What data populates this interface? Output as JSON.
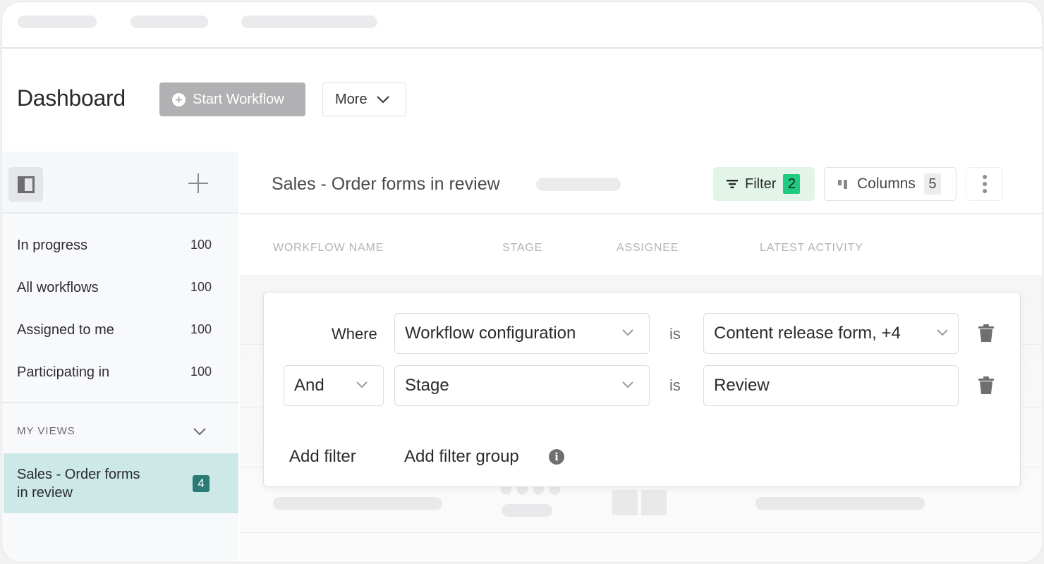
{
  "header": {
    "title": "Dashboard",
    "start_workflow_label": "Start Workflow",
    "more_label": "More"
  },
  "sidebar": {
    "items": [
      {
        "label": "In progress",
        "count": "100"
      },
      {
        "label": "All workflows",
        "count": "100"
      },
      {
        "label": "Assigned to me",
        "count": "100"
      },
      {
        "label": "Participating in",
        "count": "100"
      }
    ],
    "section_label": "MY VIEWS",
    "views": [
      {
        "label": "Sales - Order forms in review",
        "count": "4"
      }
    ]
  },
  "main": {
    "view_title": "Sales - Order forms in review",
    "filter_label": "Filter",
    "filter_count": "2",
    "columns_label": "Columns",
    "columns_count": "5",
    "columns": [
      "WORKFLOW NAME",
      "STAGE",
      "ASSIGNEE",
      "LATEST ACTIVITY"
    ]
  },
  "filter_popover": {
    "rows": [
      {
        "connector": "Where",
        "field": "Workflow configuration",
        "operator": "is",
        "value": "Content release form, +4"
      },
      {
        "connector": "And",
        "field": "Stage",
        "operator": "is",
        "value": "Review"
      }
    ],
    "add_filter_label": "Add filter",
    "add_filter_group_label": "Add filter group",
    "info_glyph": "i"
  },
  "colors": {
    "accent_teal": "#2a7a78",
    "selected_view_bg": "#cce8e7",
    "filter_active_bg": "#e2f5e8",
    "filter_badge": "#1fcc7f",
    "disabled_button": "#b1b1b4"
  }
}
